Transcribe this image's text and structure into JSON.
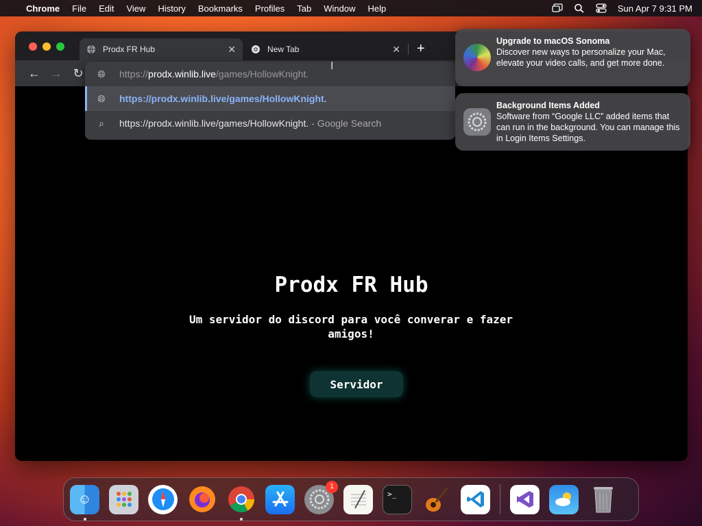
{
  "menubar": {
    "app_name": "Chrome",
    "items": [
      "File",
      "Edit",
      "View",
      "History",
      "Bookmarks",
      "Profiles",
      "Tab",
      "Window",
      "Help"
    ],
    "clock": "Sun Apr 7  9:31 PM"
  },
  "browser": {
    "tabs": [
      {
        "title": "Prodx FR Hub",
        "active": true
      },
      {
        "title": "New Tab",
        "active": false
      }
    ],
    "omnibox": {
      "prefix": "https://",
      "host": "prodx.winlib.live",
      "path": "/games/HollowKnight.",
      "suggestions": [
        {
          "text": "https://prodx.winlib.live/games/HollowKnight.",
          "suffix": ""
        },
        {
          "text": "https://prodx.winlib.live/games/HollowKnight.",
          "suffix": "- Google Search"
        }
      ]
    }
  },
  "page": {
    "title": "Prodx FR Hub",
    "subtitle": "Um servidor do discord para você converar e fazer amigos!",
    "button_label": "Servidor"
  },
  "notifications": [
    {
      "title": "Upgrade to macOS Sonoma",
      "body": "Discover new ways to personalize your Mac, elevate your video calls, and get more done."
    },
    {
      "title": "Background Items Added",
      "body": "Software from “Google LLC” added items that can run in the background. You can manage this in Login Items Settings."
    }
  ],
  "dock": {
    "settings_badge": "1"
  },
  "colors": {
    "accent_link": "#8ab4f8",
    "button_bg": "#0e3332"
  }
}
